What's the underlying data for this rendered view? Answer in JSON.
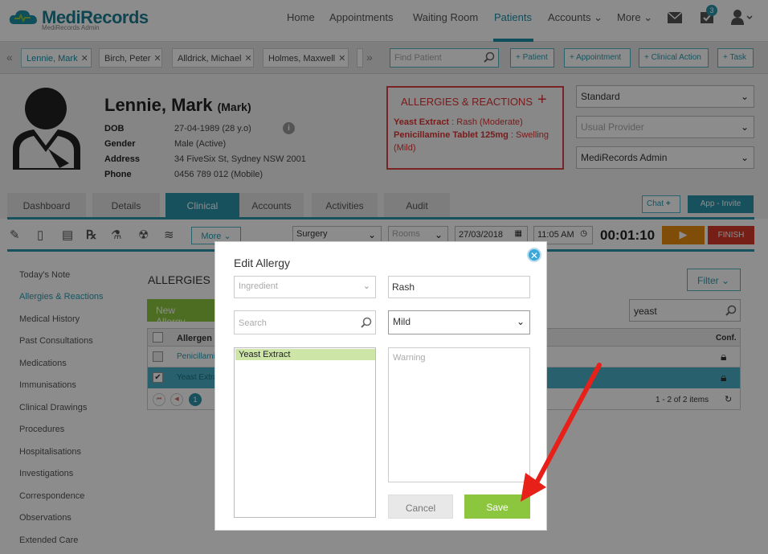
{
  "app": {
    "logo": "MediRecords",
    "logo_sub": "MediRecords Admin"
  },
  "nav": {
    "items": [
      "Home",
      "Appointments",
      "Waiting Room",
      "Patients",
      "Accounts",
      "More"
    ],
    "active": "Patients",
    "notification_count": "3"
  },
  "patient_tabs": [
    {
      "label": "Lennie, Mark"
    },
    {
      "label": "Birch, Peter"
    },
    {
      "label": "Alldrick, Michael"
    },
    {
      "label": "Holmes, Maxwell"
    }
  ],
  "find_patient_placeholder": "Find Patient",
  "actions": [
    "+ Patient",
    "+ Appointment",
    "+ Clinical Action",
    "+ Task"
  ],
  "patient": {
    "name": "Lennie, Mark",
    "preferred": "(Mark)",
    "dob_label": "DOB",
    "dob": "27-04-1989 (28 y.o)",
    "gender_label": "Gender",
    "gender": "Male (Active)",
    "address_label": "Address",
    "address": "34 FiveSix St, Sydney NSW 2001",
    "phone_label": "Phone",
    "phone": "0456 789 012 (Mobile)"
  },
  "allergy_box": {
    "title": "ALLERGIES & REACTIONS",
    "items": [
      {
        "name": "Yeast Extract",
        "reaction": " : Rash (Moderate)"
      },
      {
        "name": "Penicillamine Tablet 125mg",
        "reaction": " : Swelling (Mild)"
      }
    ]
  },
  "header_selects": {
    "type": "Standard",
    "provider_placeholder": "Usual Provider",
    "admin": "MediRecords Admin"
  },
  "main_tabs": [
    "Dashboard",
    "Details",
    "Clinical",
    "Accounts",
    "Activities",
    "Audit"
  ],
  "chat_label": "Chat",
  "app_invite_label": "App - Invite",
  "toolbar": {
    "more_label": "More",
    "surgery": "Surgery",
    "rooms": "Rooms",
    "date": "27/03/2018",
    "time": "11:05 AM",
    "timer": "00:01:10",
    "finish_label": "FINISH"
  },
  "sidebar": [
    "Today's Note",
    "Allergies & Reactions",
    "Medical History",
    "Past Consultations",
    "Medications",
    "Immunisations",
    "Clinical Drawings",
    "Procedures",
    "Hospitalisations",
    "Investigations",
    "Correspondence",
    "Observations",
    "Extended Care"
  ],
  "content": {
    "heading": "ALLERGIES",
    "new_button": "New Allergy",
    "filter_label": "Filter",
    "search_value": "yeast",
    "col_allergen": "Allergen",
    "col_conf": "Conf.",
    "rows": [
      "Penicillamin",
      "Yeast Extra"
    ],
    "pager_page": "1",
    "items_count": "1 - 2 of 2 items"
  },
  "modal": {
    "title": "Edit Allergy",
    "ingredient_placeholder": "Ingredient",
    "search_placeholder": "Search",
    "selected_ingredient": "Yeast Extract",
    "reaction_value": "Rash",
    "severity_value": "Mild",
    "warning_placeholder": "Warning",
    "cancel_label": "Cancel",
    "save_label": "Save"
  },
  "colors": {
    "accent": "#2a94aa",
    "brand": "#1d7f93",
    "save": "#8cc63f",
    "alert": "#d33333",
    "arrow": "#e8201a"
  }
}
